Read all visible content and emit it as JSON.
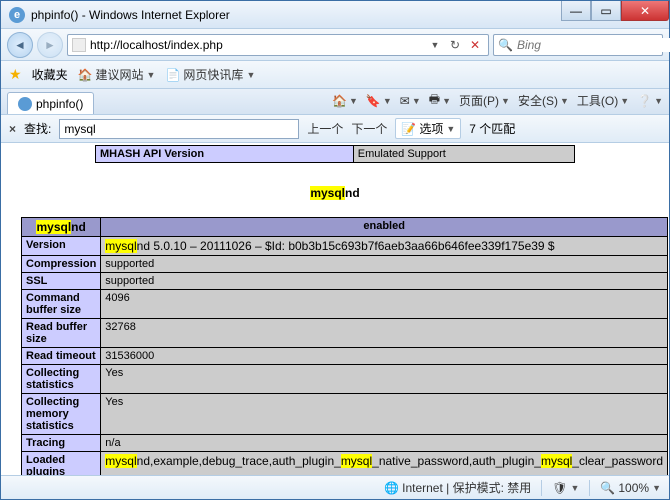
{
  "window": {
    "title": "phpinfo() - Windows Internet Explorer"
  },
  "nav": {
    "url": "http://localhost/index.php"
  },
  "search": {
    "placeholder": "Bing"
  },
  "favbar": {
    "label": "收藏夹",
    "item1": "建议网站",
    "item2": "网页快讯库"
  },
  "tab": {
    "title": "phpinfo()"
  },
  "toolbar": {
    "page": "页面(P)",
    "safety": "安全(S)",
    "tools": "工具(O)"
  },
  "findbar": {
    "label": "查找:",
    "value": "mysql",
    "prev": "上一个",
    "next": "下一个",
    "options": "选项",
    "matches": "7 个匹配"
  },
  "top_table": {
    "k": "MHASH API Version",
    "v": "Emulated Support"
  },
  "section": {
    "pre": "mysql",
    "post": "nd"
  },
  "ext": {
    "hdr_pre": "mysql",
    "hdr_post": "nd",
    "hdr_right": "enabled",
    "rows": [
      {
        "k": "Version",
        "pre": "mysql",
        "v": "nd 5.0.10 – 20111026 – $Id: b0b3b15c693b7f6aeb3aa66b646fee339f175e39 $"
      },
      {
        "k": "Compression",
        "v": "supported"
      },
      {
        "k": "SSL",
        "v": "supported"
      },
      {
        "k": "Command buffer size",
        "v": "4096"
      },
      {
        "k": "Read buffer size",
        "v": "32768"
      },
      {
        "k": "Read timeout",
        "v": "31536000"
      },
      {
        "k": "Collecting statistics",
        "v": "Yes"
      },
      {
        "k": "Collecting memory statistics",
        "v": "Yes"
      },
      {
        "k": "Tracing",
        "v": "n/a"
      }
    ],
    "loaded_k": "Loaded plugins",
    "loaded": {
      "p0": "mysql",
      "p1": "nd,example,debug_trace,auth_plugin_",
      "p2": "mysql",
      "p3": "_native_password,auth_plugin_",
      "p4": "mysql",
      "p5": "_clear_password"
    }
  },
  "status": {
    "mode": "Internet | 保护模式: 禁用",
    "zoom": "100%"
  }
}
